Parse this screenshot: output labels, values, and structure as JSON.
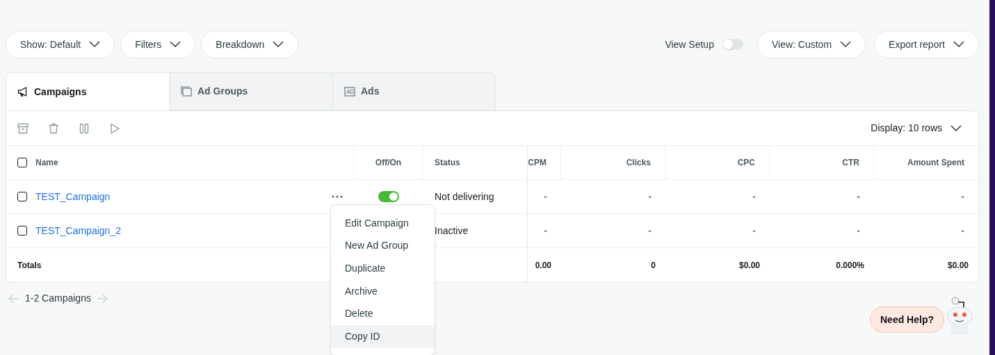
{
  "toolbar": {
    "left": [
      "Show: Default",
      "Filters",
      "Breakdown"
    ],
    "view_setup": {
      "label": "View Setup",
      "on": false
    },
    "right": [
      "View: Custom",
      "Export report"
    ]
  },
  "tabs": [
    {
      "label": "Campaigns",
      "selected": true
    },
    {
      "label": "Ad Groups",
      "selected": false
    },
    {
      "label": "Ads",
      "selected": false
    }
  ],
  "display": "Display: 10 rows",
  "table": {
    "select_all_checked": false,
    "columns": [
      "Name",
      "Off/On",
      "Status",
      "CPM",
      "Clicks",
      "CPC",
      "CTR",
      "Amount Spent"
    ],
    "rows": [
      {
        "checked": false,
        "on": true,
        "cells": [
          "TEST_Campaign",
          "",
          "Not delivering",
          "-",
          "-",
          "-",
          "-",
          "-"
        ]
      },
      {
        "checked": false,
        "cells": [
          "TEST_Campaign_2",
          "",
          "Inactive",
          "-",
          "-",
          "-",
          "-",
          "-"
        ]
      }
    ],
    "totals": {
      "cells": [
        "Totals",
        "",
        "",
        "0.00",
        "0",
        "$0.00",
        "0.000%",
        "$0.00"
      ]
    }
  },
  "row_menu": [
    {
      "label": "Edit Campaign",
      "selected": false
    },
    {
      "label": "New Ad Group",
      "selected": false
    },
    {
      "label": "Duplicate",
      "selected": false
    },
    {
      "label": "Archive",
      "selected": false
    },
    {
      "label": "Delete",
      "selected": false
    },
    {
      "label": "Copy ID",
      "selected": true
    }
  ],
  "pagination": "1-2 Campaigns",
  "help": "Need Help?"
}
